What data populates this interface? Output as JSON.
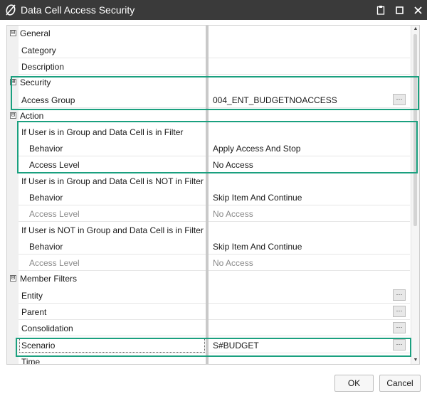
{
  "window": {
    "title": "Data Cell Access Security",
    "logo_icon": "italic-slashed-zero-logo",
    "controls": [
      "clipboard-icon",
      "restore-icon",
      "close-icon"
    ]
  },
  "grid": {
    "general": {
      "label": "General",
      "toggle": "⊟",
      "category": {
        "name": "Category",
        "value": ""
      },
      "description": {
        "name": "Description",
        "value": ""
      }
    },
    "security": {
      "label": "Security",
      "toggle": "⊞",
      "access_group": {
        "name": "Access Group",
        "value": "004_ENT_BUDGETNOACCESS"
      }
    },
    "action": {
      "label": "Action",
      "toggle": "⊟",
      "group1": {
        "label": "If User is in Group and Data Cell is in Filter",
        "behavior": {
          "name": "Behavior",
          "value": "Apply Access And Stop"
        },
        "access_level": {
          "name": "Access Level",
          "value": "No Access"
        }
      },
      "group2": {
        "label": "If User is in Group and Data Cell is NOT in Filter",
        "behavior": {
          "name": "Behavior",
          "value": "Skip Item And Continue"
        },
        "access_level": {
          "name": "Access Level",
          "value": "No Access"
        }
      },
      "group3": {
        "label": "If User is NOT in Group and Data Cell is in Filter",
        "behavior": {
          "name": "Behavior",
          "value": "Skip Item And Continue"
        },
        "access_level": {
          "name": "Access Level",
          "value": "No Access"
        }
      }
    },
    "member_filters": {
      "label": "Member Filters",
      "toggle": "⊟",
      "entity": {
        "name": "Entity",
        "value": ""
      },
      "parent": {
        "name": "Parent",
        "value": ""
      },
      "consolidation": {
        "name": "Consolidation",
        "value": ""
      },
      "scenario": {
        "name": "Scenario",
        "value": "S#BUDGET"
      },
      "time": {
        "name": "Time",
        "value": ""
      }
    },
    "ellipsis_label": "···"
  },
  "footer": {
    "ok_label": "OK",
    "cancel_label": "Cancel"
  },
  "colors": {
    "titlebar": "#3a3a3a",
    "highlight": "#1aa07f"
  }
}
